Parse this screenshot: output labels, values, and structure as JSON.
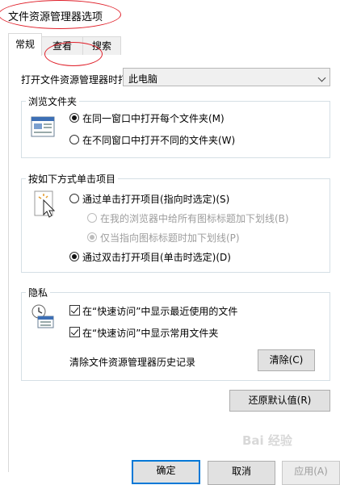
{
  "window": {
    "title": "文件资源管理器选项"
  },
  "tabs": [
    {
      "label": "常规",
      "active": true
    },
    {
      "label": "查看",
      "active": false
    },
    {
      "label": "搜索",
      "active": false
    }
  ],
  "open_explorer": {
    "label": "打开文件资源管理器时打",
    "selected": "此电脑"
  },
  "browse_folders": {
    "title": "浏览文件夹",
    "options": [
      {
        "label": "在同一窗口中打开每个文件夹(M)",
        "checked": true
      },
      {
        "label": "在不同窗口中打开不同的文件夹(W)",
        "checked": false
      }
    ]
  },
  "click_items": {
    "title": "按如下方式单击项目",
    "options": [
      {
        "label": "通过单击打开项目(指向时选定)(S)",
        "checked": false
      },
      {
        "label": "在我的浏览器中给所有图标标题加下划线(B)",
        "checked": false,
        "disabled": true
      },
      {
        "label": "仅当指向图标标题时加下划线(P)",
        "checked": true,
        "disabled": true
      },
      {
        "label": "通过双击打开项目(单击时选定)(D)",
        "checked": true
      }
    ]
  },
  "privacy": {
    "title": "隐私",
    "checks": [
      {
        "label": "在“快速访问”中显示最近使用的文件",
        "checked": true
      },
      {
        "label": "在“快速访问”中显示常用文件夹",
        "checked": true
      }
    ],
    "clear_label": "清除文件资源管理器历史记录",
    "clear_button": "清除(C)"
  },
  "restore_defaults": "还原默认值(R)",
  "footer": {
    "ok": "确定",
    "cancel": "取消",
    "apply": "应用(A)"
  },
  "watermark": "Bai 经验",
  "colors": {
    "annotation": "#e0202a",
    "focus": "#0078d7",
    "group_border": "#d5dfe5"
  }
}
